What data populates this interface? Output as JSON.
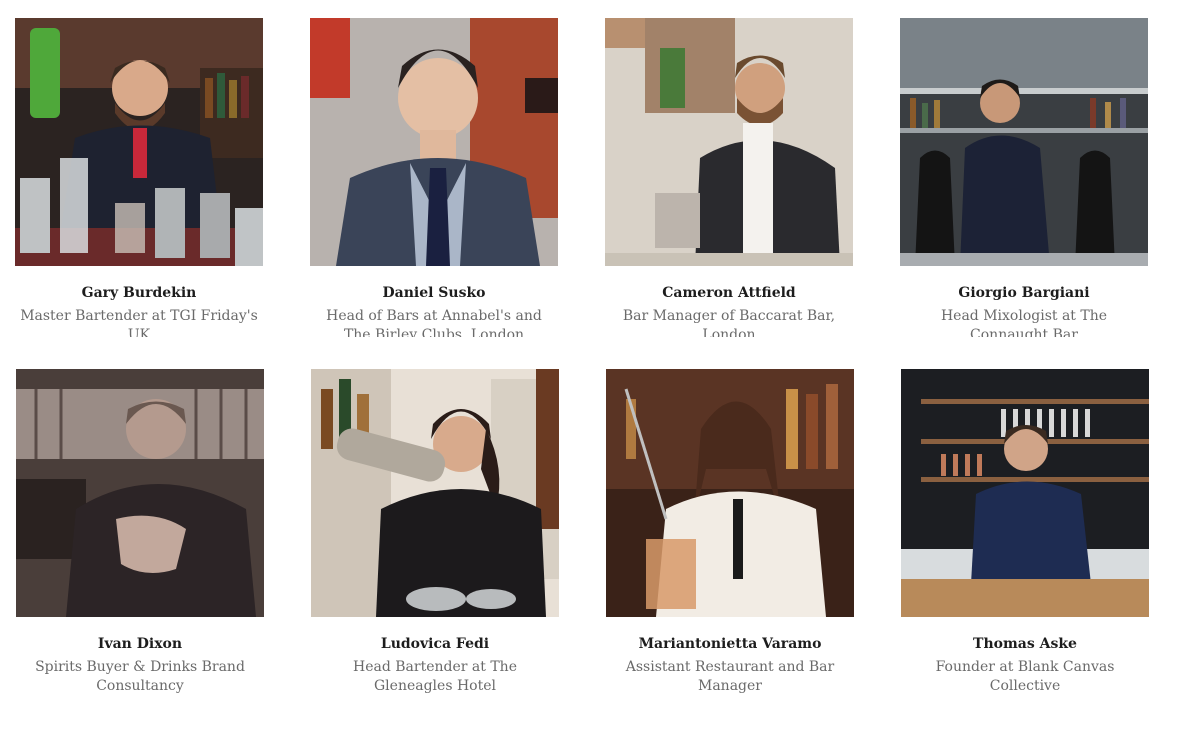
{
  "people": [
    {
      "name": "Gary Burdekin",
      "role": "Master Bartender at TGI Friday's UK",
      "photo": "bartender-photo-pouring",
      "clipped": true
    },
    {
      "name": "Daniel Susko",
      "role": "Head of Bars at Annabel's and The Birley Clubs, London",
      "photo": "portrait-photo-suit",
      "clipped": true
    },
    {
      "name": "Cameron Attfield",
      "role": "Bar Manager of Baccarat Bar, London",
      "photo": "bartender-photo-mixing",
      "clipped": true
    },
    {
      "name": "Giorgio Bargiani",
      "role": "Head Mixologist at The Connaught Bar",
      "photo": "portrait-photo-bar-shelves",
      "clipped": true
    },
    {
      "name": "Ivan Dixon",
      "role": "Spirits Buyer & Drinks Brand Consultancy",
      "photo": "portrait-photo-sepia",
      "clipped": false
    },
    {
      "name": "Ludovica Fedi",
      "role": "Head Bartender at The Gleneagles Hotel",
      "photo": "bartender-photo-shaker",
      "clipped": false
    },
    {
      "name": "Mariantonietta Varamo",
      "role": "Assistant Restaurant and Bar Manager",
      "photo": "bartender-photo-stirring",
      "clipped": false
    },
    {
      "name": "Thomas Aske",
      "role": "Founder at Blank Canvas Collective",
      "photo": "portrait-photo-dark-bar",
      "clipped": false
    }
  ]
}
